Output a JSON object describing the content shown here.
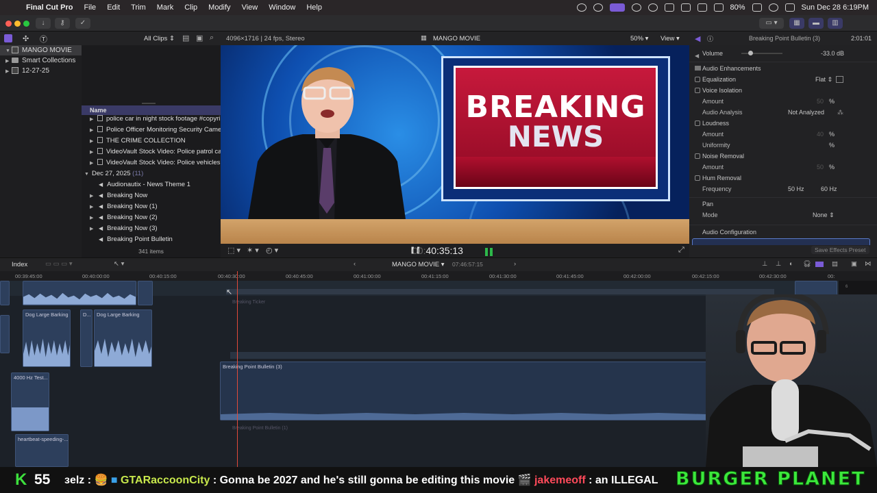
{
  "menubar": {
    "app": "Final Cut Pro",
    "items": [
      "File",
      "Edit",
      "Trim",
      "Mark",
      "Clip",
      "Modify",
      "View",
      "Window",
      "Help"
    ],
    "battery": "80%",
    "datetime": "Sun Dec 28  6:19PM"
  },
  "browser": {
    "filter": "All Clips",
    "libraries": [
      {
        "label": "MANGO MOVIE",
        "selected": true
      },
      {
        "label": "Smart Collections"
      },
      {
        "label": "12-27-25"
      }
    ],
    "name_header": "Name",
    "clips": [
      {
        "label": "police  car in night stock footage #copyri",
        "kind": "video"
      },
      {
        "label": "Police Officer Monitoring Security Camer",
        "kind": "video"
      },
      {
        "label": "THE CRIME COLLECTION",
        "kind": "video"
      },
      {
        "label": "VideoVault Stock Video:   Police patrol ca",
        "kind": "video"
      },
      {
        "label": "VideoVault Stock Video:   Police vehicles",
        "kind": "video"
      }
    ],
    "event": {
      "label": "Dec 27, 2025",
      "count": "(11)"
    },
    "audio_clips": [
      {
        "label": "Audionautix - News Theme 1"
      },
      {
        "label": "Breaking Now"
      },
      {
        "label": "Breaking Now (1)"
      },
      {
        "label": "Breaking Now (2)"
      },
      {
        "label": "Breaking Now (3)"
      },
      {
        "label": "Breaking Point Bulletin"
      }
    ],
    "item_count": "341 items"
  },
  "viewer": {
    "format": "4096×1716 | 24 fps, Stereo",
    "project": "MANGO MOVIE",
    "zoom": "50%",
    "view": "View",
    "banner_line1": "BREAKING",
    "banner_line2": "NEWS",
    "timecode_dim": "00:",
    "timecode": "40:35:13"
  },
  "inspector": {
    "title": "Breaking Point Bulletin (3)",
    "duration": "2:01:01",
    "volume_label": "Volume",
    "volume_value": "-33.0  dB",
    "enhancements_label": "Audio Enhancements",
    "equalization_label": "Equalization",
    "equalization_value": "Flat",
    "voice_isolation": "Voice Isolation",
    "amount_label": "Amount",
    "amount_unit": "%",
    "ghost_50": "50",
    "ghost_40": "40",
    "audio_analysis_label": "Audio Analysis",
    "audio_analysis_value": "Not Analyzed",
    "loudness": "Loudness",
    "uniformity": "Uniformity",
    "noise_removal": "Noise Removal",
    "hum_removal": "Hum Removal",
    "frequency_label": "Frequency",
    "freq_50": "50 Hz",
    "freq_60": "60 Hz",
    "pan_label": "Pan",
    "mode_label": "Mode",
    "mode_value": "None",
    "audio_config": "Audio Configuration",
    "save_preset": "Save Effects Preset"
  },
  "timeline": {
    "index": "Index",
    "project": "MANGO MOVIE",
    "duration": "07:46:57:15",
    "ruler": [
      "00:39:45:00",
      "00:40:00:00",
      "00:40:15:00",
      "00:40:30:00",
      "00:40:45:00",
      "00:41:00:00",
      "00:41:15:00",
      "00:41:30:00",
      "00:41:45:00",
      "00:42:00:00",
      "00:42:15:00",
      "00:42:30:00",
      "00:"
    ],
    "clips": {
      "dog1": "Dog Large Barking",
      "dogd": "D...",
      "dog2": "Dog Large Barking",
      "sine": "4000 Hz Test...",
      "heart": "heartbeat-speeding-...",
      "ticker": "Breaking Ticker",
      "bulletin": "Breaking Point Bulletin (3)",
      "bulletin1": "Breaking Point Bulletin (1)"
    }
  },
  "ticker": {
    "k": "K",
    "k_count": "55",
    "user0": "ɜelz",
    "sep0": " : 🍔  ",
    "user1": "GTARaccoonCity",
    "msg1": " : Gonna be 2027 and he's still gonna be editing this movie 🎬  ",
    "user2": "jakemeoff",
    "msg2": " : an ILLEGAL",
    "brand": "BURGER PLANET"
  }
}
